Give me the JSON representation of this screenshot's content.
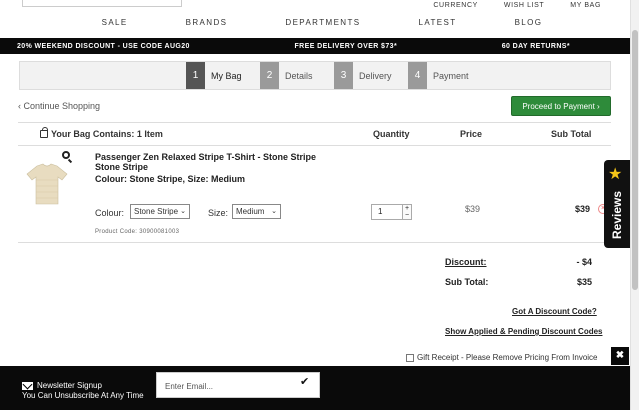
{
  "util_nav": [
    "CURRENCY",
    "WISH LIST",
    "MY BAG"
  ],
  "main_nav": [
    "SALE",
    "BRANDS",
    "DEPARTMENTS",
    "LATEST",
    "BLOG"
  ],
  "promo": {
    "left": "20% WEEKEND DISCOUNT - USE CODE AUG20",
    "center": "FREE DELIVERY OVER $73*",
    "right": "60 DAY RETURNS*"
  },
  "steps": [
    {
      "num": "1",
      "label": "My Bag",
      "active": true
    },
    {
      "num": "2",
      "label": "Details",
      "active": false
    },
    {
      "num": "3",
      "label": "Delivery",
      "active": false
    },
    {
      "num": "4",
      "label": "Payment",
      "active": false
    }
  ],
  "continue_link": "‹ Continue Shopping",
  "proceed_button": "Proceed to Payment ›",
  "table": {
    "bag_title": "Your Bag Contains: 1 Item",
    "col_quantity": "Quantity",
    "col_price": "Price",
    "col_subtotal": "Sub Total"
  },
  "item": {
    "name": "Passenger Zen Relaxed Stripe T-Shirt - Stone Stripe Stone Stripe",
    "colour_size": "Colour: Stone Stripe, Size: Medium",
    "colour_label": "Colour:",
    "colour_value": "Stone Stripe",
    "size_label": "Size:",
    "size_value": "Medium",
    "product_code": "Product Code: 30900081003",
    "quantity": "1",
    "price": "$39",
    "subtotal": "$39",
    "accent_color": "#e8dcc0"
  },
  "totals": {
    "discount_label": "Discount:",
    "discount_value": "- $4",
    "subtotal_label": "Sub Total:",
    "subtotal_value": "$35",
    "discount_code_link": "Got A Discount Code?",
    "pending_link": "Show Applied & Pending Discount Codes"
  },
  "gift_receipt": "Gift Receipt - Please Remove Pricing From Invoice",
  "reviews": {
    "label": "Reviews",
    "star": "★"
  },
  "newsletter": {
    "title": "Newsletter Signup",
    "subtitle": "You Can Unsubscribe At Any Time",
    "placeholder": "Enter Email...",
    "submit": "✔",
    "close": "✖"
  },
  "colors": {
    "proceed": "#2e8b3a",
    "banner": "#0a0a0a",
    "star": "#f5c518"
  }
}
